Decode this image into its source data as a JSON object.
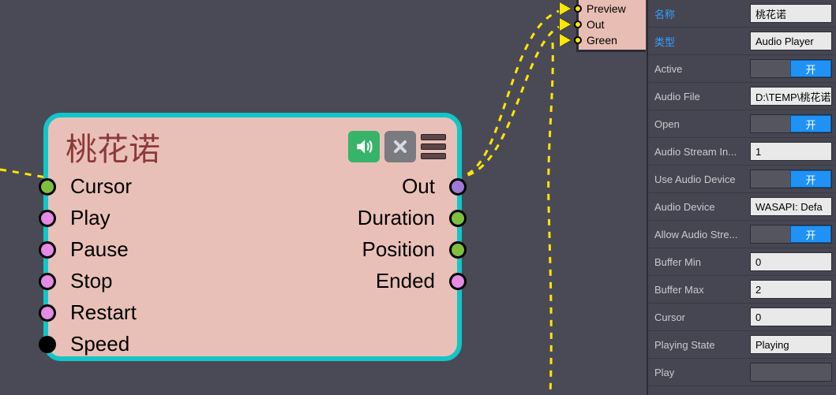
{
  "node": {
    "title": "桃花诺",
    "inputs": [
      {
        "label": "Cursor",
        "color": "green"
      },
      {
        "label": "Play",
        "color": "magenta"
      },
      {
        "label": "Pause",
        "color": "magenta"
      },
      {
        "label": "Stop",
        "color": "magenta"
      },
      {
        "label": "Restart",
        "color": "magenta"
      },
      {
        "label": "Speed",
        "color": "black"
      }
    ],
    "outputs": [
      {
        "label": "Out",
        "color": "purple"
      },
      {
        "label": "Duration",
        "color": "green"
      },
      {
        "label": "Position",
        "color": "green"
      },
      {
        "label": "Ended",
        "color": "magenta"
      }
    ]
  },
  "dest": {
    "ports": [
      {
        "label": "Preview"
      },
      {
        "label": "Out"
      },
      {
        "label": "Green"
      }
    ]
  },
  "panel": {
    "rows": [
      {
        "label": "名称",
        "labelClass": "link",
        "type": "text",
        "value": "桃花诺"
      },
      {
        "label": "类型",
        "labelClass": "link",
        "type": "text",
        "value": "Audio Player"
      },
      {
        "label": "Active",
        "type": "toggle",
        "value": "开"
      },
      {
        "label": "Audio File",
        "type": "text",
        "value": "D:\\TEMP\\桃花诺"
      },
      {
        "label": "Open",
        "type": "toggle",
        "value": "开"
      },
      {
        "label": "Audio Stream In...",
        "type": "text",
        "value": "1"
      },
      {
        "label": "Use Audio Device",
        "type": "toggle",
        "value": "开"
      },
      {
        "label": "Audio Device",
        "type": "text",
        "value": "WASAPI: Defa"
      },
      {
        "label": "Allow Audio Stre...",
        "type": "toggle",
        "value": "开"
      },
      {
        "label": "Buffer Min",
        "type": "text",
        "value": "0"
      },
      {
        "label": "Buffer Max",
        "type": "text",
        "value": "2"
      },
      {
        "label": "Cursor",
        "type": "text",
        "value": "0"
      },
      {
        "label": "Playing State",
        "type": "text",
        "value": "Playing"
      },
      {
        "label": "Play",
        "type": "toggle_off",
        "value": ""
      }
    ]
  },
  "colors": {
    "connection": "#ffe600"
  }
}
